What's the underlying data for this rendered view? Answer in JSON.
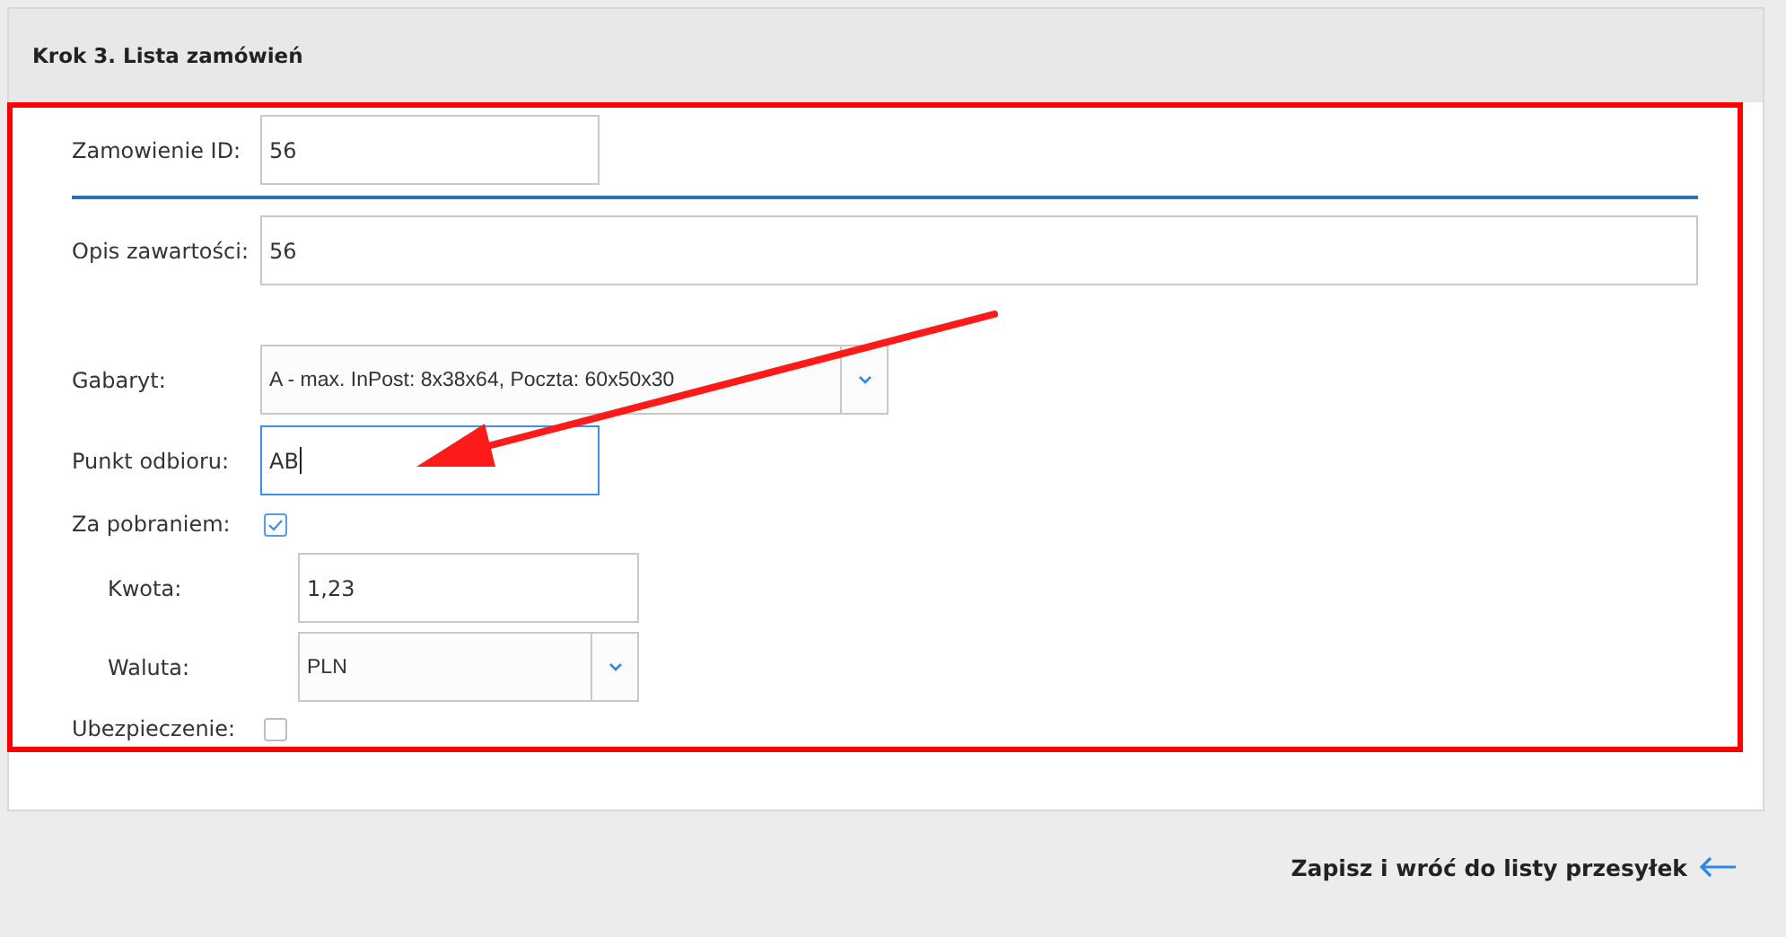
{
  "header": {
    "title": "Krok 3. Lista zamówień"
  },
  "order_id": {
    "label": "Zamowienie ID:",
    "value": "56"
  },
  "description": {
    "label": "Opis zawartości:",
    "value": "56"
  },
  "size": {
    "label": "Gabaryt:",
    "value": "A - max. InPost: 8x38x64, Poczta: 60x50x30"
  },
  "pickup_point": {
    "label": "Punkt odbioru:",
    "value": "AB",
    "focused": true
  },
  "cash_on_delivery": {
    "label": "Za pobraniem:",
    "checked": true
  },
  "amount": {
    "label": "Kwota:",
    "value": "1,23"
  },
  "currency": {
    "label": "Waluta:",
    "value": "PLN"
  },
  "insurance": {
    "label": "Ubezpieczenie:",
    "checked": false
  },
  "save_link": {
    "label": "Zapisz i wróć do listy przesyłek"
  }
}
